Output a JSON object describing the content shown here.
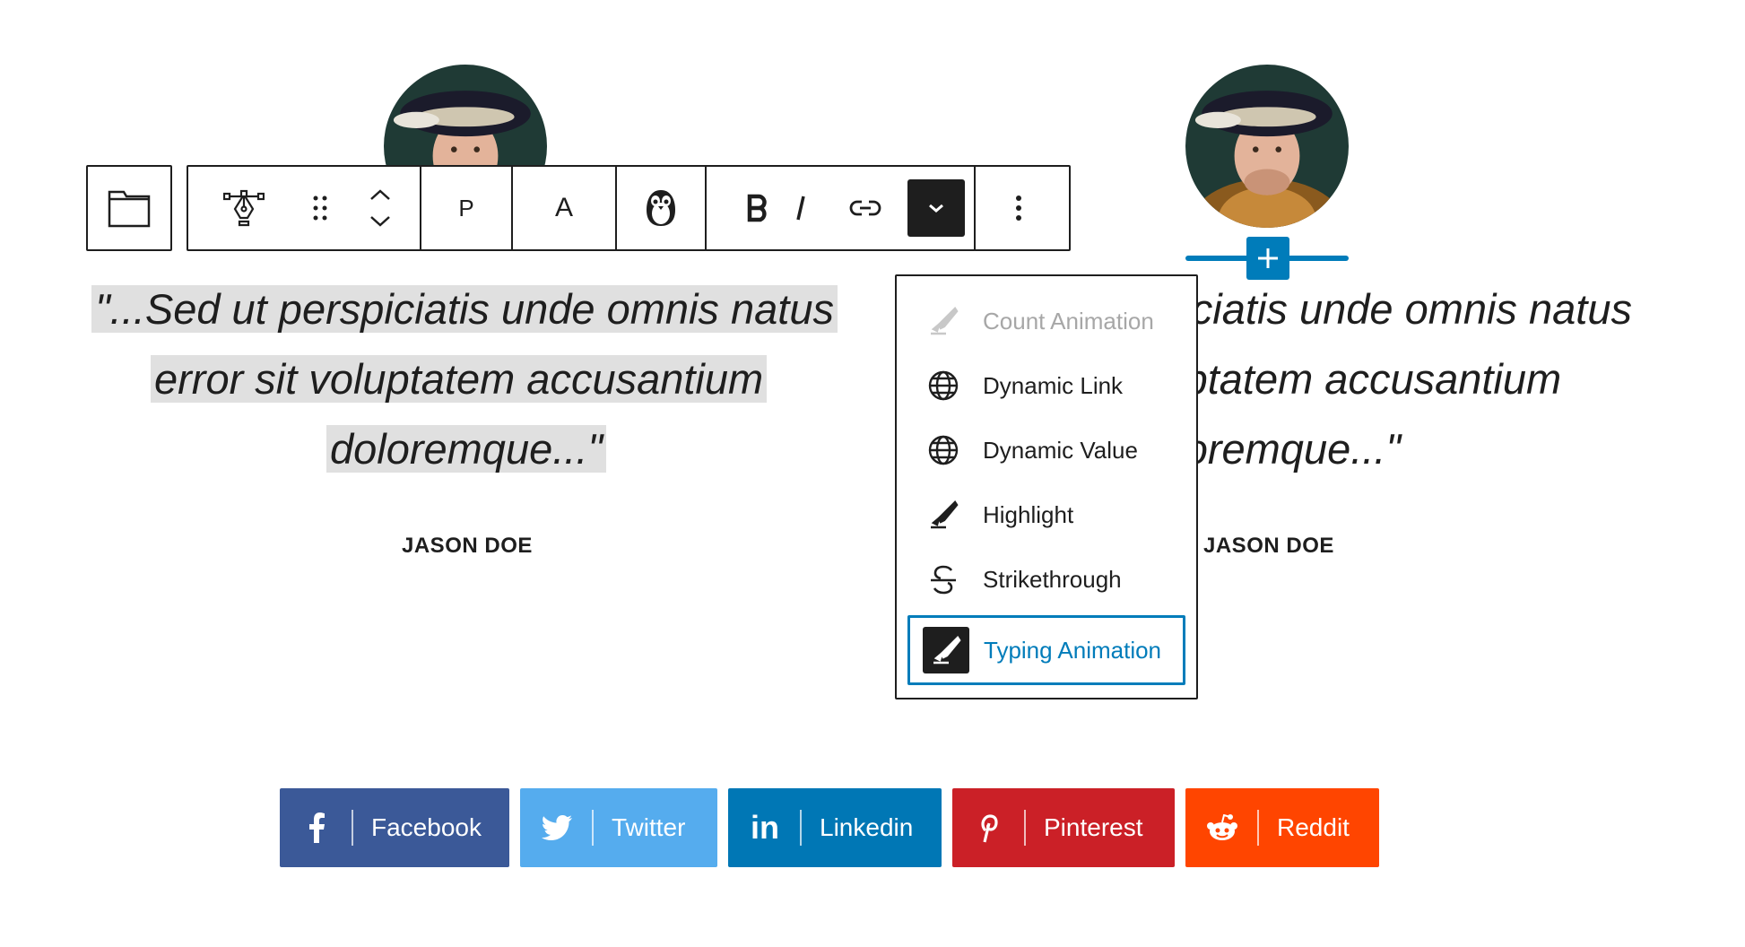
{
  "toolbar": {
    "paragraph_label": "P",
    "text_label": "A"
  },
  "left_block": {
    "quote_lines": [
      "\"...Sed ut perspiciatis unde omnis natus",
      "error sit voluptatem accusantium",
      "doloremque...\""
    ],
    "author": "JASON DOE"
  },
  "right_block": {
    "quote_lines": [
      "\"...Sed ut perspiciatis unde omnis natus",
      "error sit voluptatem accusantium",
      "doloremque...\""
    ],
    "author": "JASON DOE"
  },
  "dropdown": {
    "items": [
      {
        "label": "Count Animation",
        "icon": "brush-icon",
        "state": "disabled"
      },
      {
        "label": "Dynamic Link",
        "icon": "globe-icon",
        "state": "normal"
      },
      {
        "label": "Dynamic Value",
        "icon": "globe-icon",
        "state": "normal"
      },
      {
        "label": "Highlight",
        "icon": "brush-icon",
        "state": "normal"
      },
      {
        "label": "Strikethrough",
        "icon": "strikethrough-icon",
        "state": "normal"
      },
      {
        "label": "Typing Animation",
        "icon": "brush-icon",
        "state": "active"
      }
    ]
  },
  "share": [
    {
      "label": "Facebook",
      "icon": "facebook-icon",
      "color": "#3b5998"
    },
    {
      "label": "Twitter",
      "icon": "twitter-icon",
      "color": "#55acee"
    },
    {
      "label": "Linkedin",
      "icon": "linkedin-icon",
      "color": "#0077b5"
    },
    {
      "label": "Pinterest",
      "icon": "pinterest-icon",
      "color": "#cb2027"
    },
    {
      "label": "Reddit",
      "icon": "reddit-icon",
      "color": "#ff4500"
    }
  ],
  "colors": {
    "accent": "#007cba",
    "highlight_bg": "#e0e0e0",
    "text": "#1e1e1e"
  }
}
